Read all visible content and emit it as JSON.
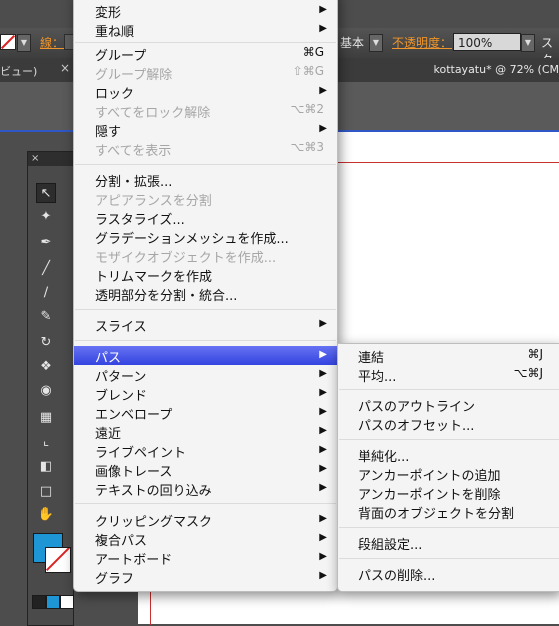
{
  "control_bar": {
    "stroke_label": "線：",
    "stroke_style": "基本",
    "opacity_label": "不透明度：",
    "opacity_value": "100%",
    "style_label": "スタ"
  },
  "tab_bar": {
    "left_tab": "ビュー)",
    "close_glyph": "×",
    "doc_title": "kottayatu* @ 72% (CM"
  },
  "tools": {
    "close_glyph": "×",
    "icons": [
      "selection-tool-icon",
      "magic-wand-tool-icon",
      "pen-tool-icon",
      "line-tool-icon",
      "brush-tool-icon",
      "blob-brush-tool-icon",
      "rotate-tool-icon",
      "width-tool-icon",
      "shape-builder-tool-icon",
      "perspective-grid-tool-icon",
      "mesh-tool-icon",
      "eyedropper-tool-icon",
      "symbol-sprayer-tool-icon",
      "artboard-tool-icon",
      "hand-tool-icon"
    ],
    "fill_color": "#1e95d4"
  },
  "menu": {
    "items": [
      {
        "label": "変形",
        "shortcut": "",
        "submenu": true,
        "disabled": false
      },
      {
        "label": "重ね順",
        "shortcut": "",
        "submenu": true,
        "disabled": false
      },
      {
        "label": "グループ",
        "shortcut": "⌘G",
        "submenu": false,
        "disabled": false
      },
      {
        "label": "グループ解除",
        "shortcut": "⇧⌘G",
        "submenu": false,
        "disabled": true
      },
      {
        "label": "ロック",
        "shortcut": "",
        "submenu": true,
        "disabled": false
      },
      {
        "label": "すべてをロック解除",
        "shortcut": "⌥⌘2",
        "submenu": false,
        "disabled": true
      },
      {
        "label": "隠す",
        "shortcut": "",
        "submenu": true,
        "disabled": false
      },
      {
        "label": "すべてを表示",
        "shortcut": "⌥⌘3",
        "submenu": false,
        "disabled": true
      },
      {
        "label": "分割・拡張...",
        "shortcut": "",
        "submenu": false,
        "disabled": false
      },
      {
        "label": "アピアランスを分割",
        "shortcut": "",
        "submenu": false,
        "disabled": true
      },
      {
        "label": "ラスタライズ...",
        "shortcut": "",
        "submenu": false,
        "disabled": false
      },
      {
        "label": "グラデーションメッシュを作成...",
        "shortcut": "",
        "submenu": false,
        "disabled": false
      },
      {
        "label": "モザイクオブジェクトを作成...",
        "shortcut": "",
        "submenu": false,
        "disabled": true
      },
      {
        "label": "トリムマークを作成",
        "shortcut": "",
        "submenu": false,
        "disabled": false
      },
      {
        "label": "透明部分を分割・統合...",
        "shortcut": "",
        "submenu": false,
        "disabled": false
      },
      {
        "label": "スライス",
        "shortcut": "",
        "submenu": true,
        "disabled": false
      },
      {
        "label": "パス",
        "shortcut": "",
        "submenu": true,
        "disabled": false,
        "highlighted": true
      },
      {
        "label": "パターン",
        "shortcut": "",
        "submenu": true,
        "disabled": false
      },
      {
        "label": "ブレンド",
        "shortcut": "",
        "submenu": true,
        "disabled": false
      },
      {
        "label": "エンベロープ",
        "shortcut": "",
        "submenu": true,
        "disabled": false
      },
      {
        "label": "遠近",
        "shortcut": "",
        "submenu": true,
        "disabled": false
      },
      {
        "label": "ライブペイント",
        "shortcut": "",
        "submenu": true,
        "disabled": false
      },
      {
        "label": "画像トレース",
        "shortcut": "",
        "submenu": true,
        "disabled": false
      },
      {
        "label": "テキストの回り込み",
        "shortcut": "",
        "submenu": true,
        "disabled": false
      },
      {
        "label": "クリッピングマスク",
        "shortcut": "",
        "submenu": true,
        "disabled": false
      },
      {
        "label": "複合パス",
        "shortcut": "",
        "submenu": true,
        "disabled": false
      },
      {
        "label": "アートボード",
        "shortcut": "",
        "submenu": true,
        "disabled": false
      },
      {
        "label": "グラフ",
        "shortcut": "",
        "submenu": true,
        "disabled": false
      }
    ]
  },
  "path_submenu": {
    "items": [
      {
        "label": "連結",
        "shortcut": "⌘J"
      },
      {
        "label": "平均...",
        "shortcut": "⌥⌘J"
      },
      {
        "label": "パスのアウトライン",
        "shortcut": ""
      },
      {
        "label": "パスのオフセット...",
        "shortcut": ""
      },
      {
        "label": "単純化...",
        "shortcut": ""
      },
      {
        "label": "アンカーポイントの追加",
        "shortcut": ""
      },
      {
        "label": "アンカーポイントを削除",
        "shortcut": ""
      },
      {
        "label": "背面のオブジェクトを分割",
        "shortcut": ""
      },
      {
        "label": "段組設定...",
        "shortcut": ""
      },
      {
        "label": "パスの削除...",
        "shortcut": ""
      }
    ]
  },
  "glyphs": {
    "submenu_arrow": "▶",
    "dropdown_arrow": "▼"
  }
}
